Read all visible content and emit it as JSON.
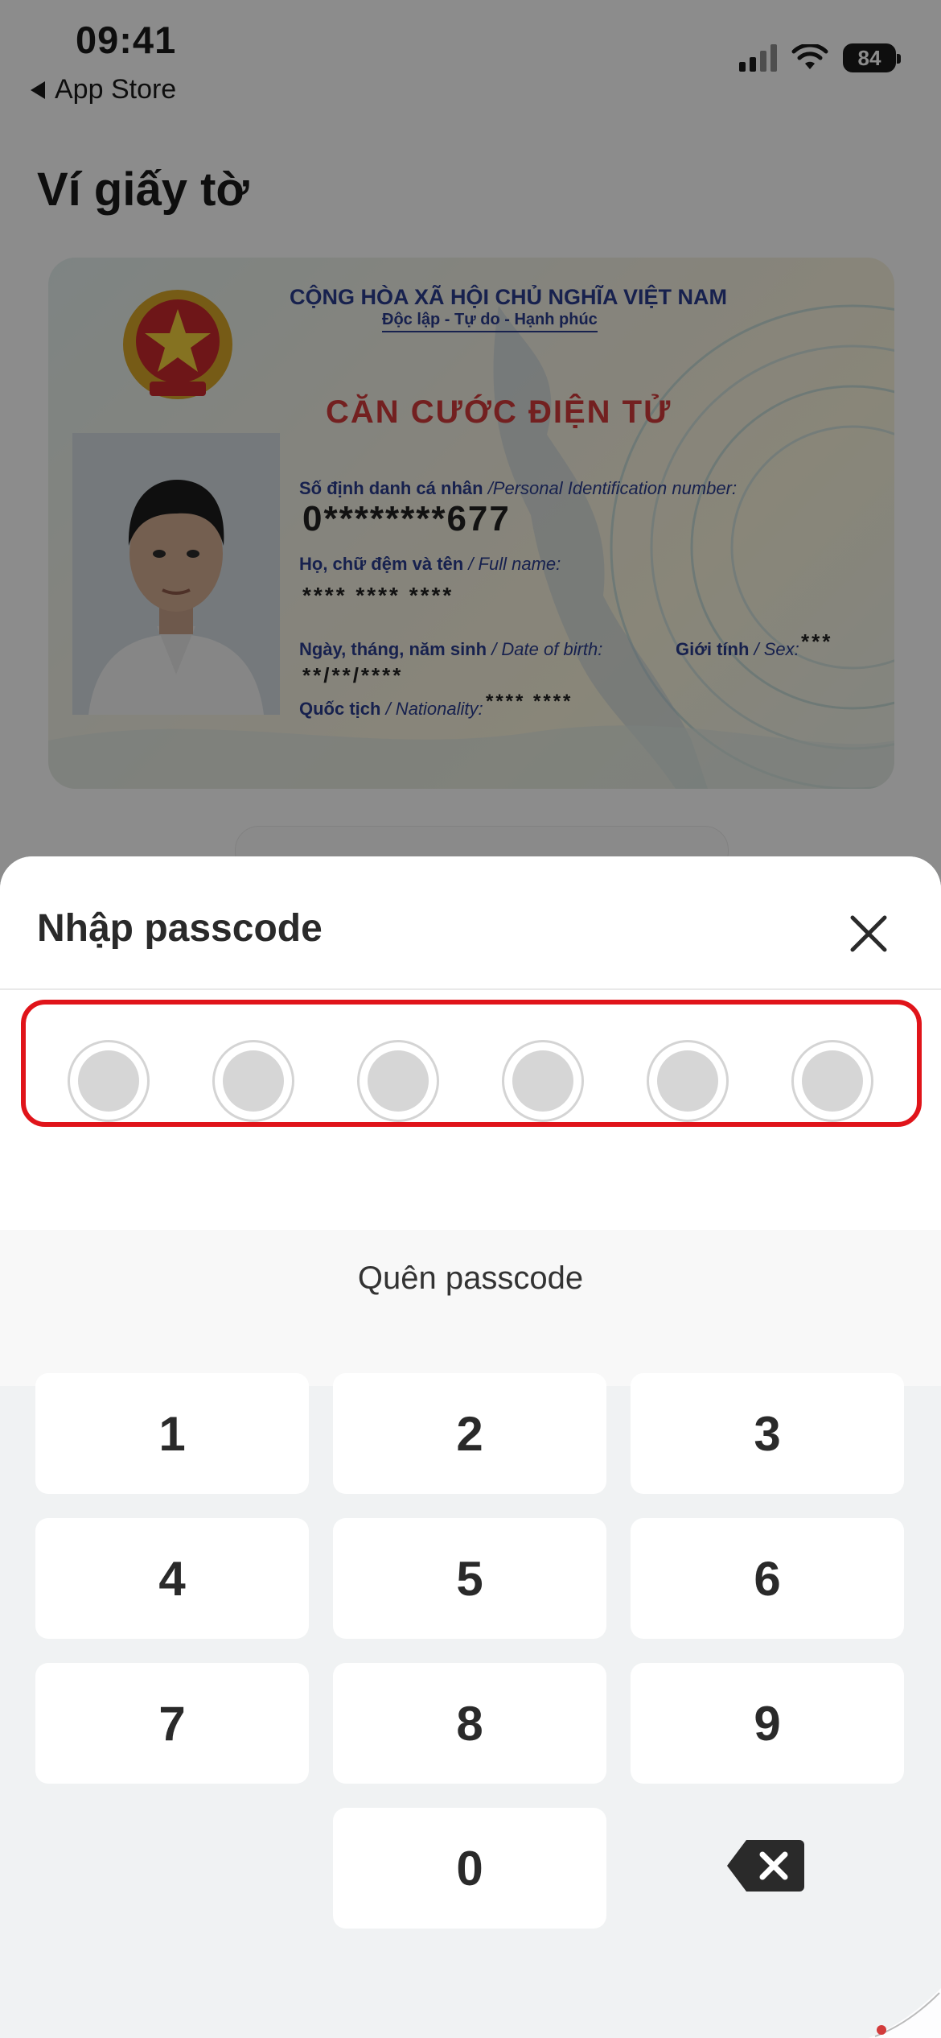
{
  "status_bar": {
    "time": "09:41",
    "back_label": "App Store",
    "battery": "84"
  },
  "page": {
    "title": "Ví giấy tờ"
  },
  "id_card": {
    "header_country": "CỘNG HÒA XÃ HỘI CHỦ NGHĨA VIỆT NAM",
    "header_motto": "Độc lập - Tự do - Hạnh phúc",
    "card_type": "CĂN CƯỚC ĐIỆN TỬ",
    "id_label_vi": "Số định danh cá nhân",
    "id_label_en": "/Personal Identification number:",
    "id_value": "0********677",
    "name_label_vi": "Họ, chữ đệm và tên",
    "name_label_en": "/ Full name:",
    "name_value": "**** **** ****",
    "dob_label_vi": "Ngày, tháng, năm sinh",
    "dob_label_en": "/ Date of birth:",
    "dob_value": "**/**/****",
    "sex_label_vi": "Giới tính",
    "sex_label_en": "/ Sex:",
    "sex_value": "***",
    "nationality_label_vi": "Quốc tịch",
    "nationality_label_en": "/ Nationality:",
    "nationality_value": "**** ****"
  },
  "sheet": {
    "title": "Nhập passcode",
    "forgot_label": "Quên passcode",
    "passcode_length": 6,
    "passcode_filled": 0,
    "highlight_color": "#e0141a"
  },
  "keypad": {
    "keys": [
      "1",
      "2",
      "3",
      "4",
      "5",
      "6",
      "7",
      "8",
      "9",
      "0"
    ],
    "backspace_icon": "backspace-icon"
  },
  "colors": {
    "card_text": "#2b3d8f",
    "card_type": "#d23b3b"
  }
}
